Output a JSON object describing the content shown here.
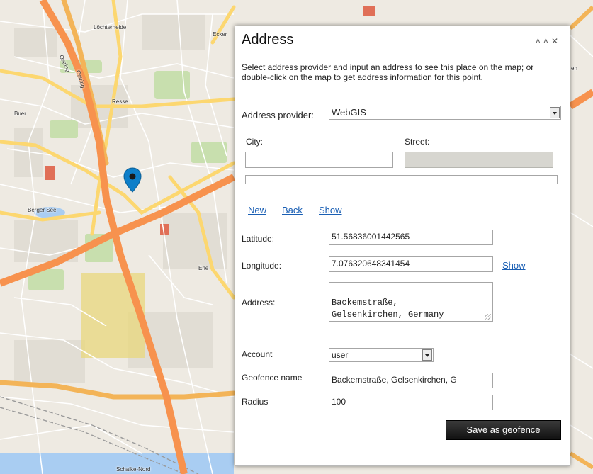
{
  "map": {
    "labels": {
      "lochterheide": "Löchterheide",
      "ecker": "Ecker",
      "buer": "Buer",
      "resse": "Resse",
      "berger_see": "Berger See",
      "erle": "Erle",
      "right_edge": "en",
      "ostring1": "Ostring",
      "ostring2": "Ostring",
      "bottom": "Schalke-Nord"
    }
  },
  "dialog": {
    "title": "Address",
    "collapse_icon": "double-chevron-up-icon",
    "close_icon": "close-icon",
    "description": "Select address provider and input an address to see this place on the map; or double-click on the map to get address information for this point.",
    "provider": {
      "label": "Address provider:",
      "value": "WebGIS"
    },
    "city": {
      "label": "City:",
      "value": ""
    },
    "street": {
      "label": "Street:",
      "value": ""
    },
    "links": {
      "new": "New",
      "back": "Back",
      "show": "Show"
    },
    "latitude": {
      "label": "Latitude:",
      "value": "51.56836001442565"
    },
    "longitude": {
      "label": "Longitude:",
      "value": "7.076320648341454",
      "show": "Show"
    },
    "address": {
      "label": "Address:",
      "value": "Backemstraße,\nGelsenkirchen, Germany"
    },
    "account": {
      "label": "Account",
      "value": "user"
    },
    "geofence_name": {
      "label": "Geofence name",
      "value": "Backemstraße, Gelsenkirchen, G"
    },
    "radius": {
      "label": "Radius",
      "value": "100"
    },
    "save_button": "Save as geofence"
  },
  "colors": {
    "highway": "#f7924e",
    "major_road": "#fcd770",
    "map_bg": "#eeeae2",
    "marker": "#0e7fc9",
    "link": "#1a5fb4"
  }
}
